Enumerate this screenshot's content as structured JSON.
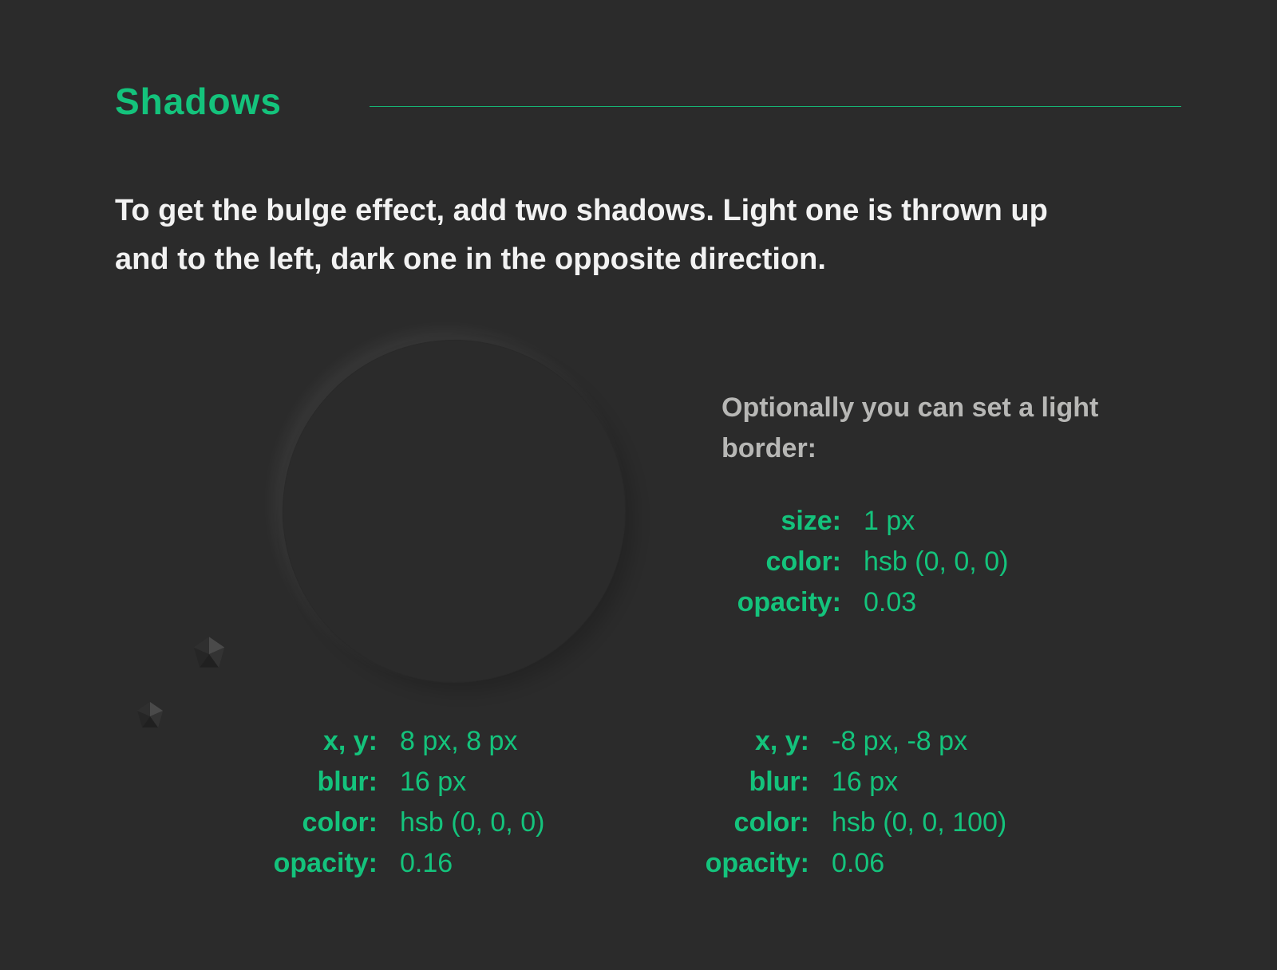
{
  "title": "Shadows",
  "intro": "To get the bulge effect, add two shadows. Light one is thrown up and to the left, dark one in the opposite direction.",
  "border": {
    "caption": "Optionally you can set a light border:",
    "rows": [
      {
        "key": "size:",
        "val": "1 px"
      },
      {
        "key": "color:",
        "val": "hsb (0, 0, 0)"
      },
      {
        "key": "opacity:",
        "val": "0.03"
      }
    ]
  },
  "shadow1": [
    {
      "key": "x, y:",
      "val": "8 px, 8 px"
    },
    {
      "key": "blur:",
      "val": "16 px"
    },
    {
      "key": "color:",
      "val": "hsb (0, 0, 0)"
    },
    {
      "key": "opacity:",
      "val": "0.16"
    }
  ],
  "shadow2": [
    {
      "key": "x, y:",
      "val": "-8 px, -8 px"
    },
    {
      "key": "blur:",
      "val": "16 px"
    },
    {
      "key": "color:",
      "val": "hsb (0, 0, 100)"
    },
    {
      "key": "opacity:",
      "val": "0.06"
    }
  ]
}
